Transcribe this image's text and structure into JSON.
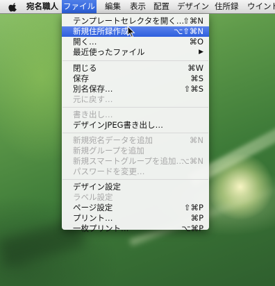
{
  "menubar": {
    "app": "宛名職人",
    "items": [
      "ファイル",
      "編集",
      "表示",
      "配置",
      "デザイン",
      "住所録",
      "ウインド"
    ]
  },
  "file_menu": {
    "items": [
      {
        "label": "テンプレートセレクタを開く…",
        "shortcut": "⇧⌘N",
        "enabled": true
      },
      {
        "label": "新規住所録作成",
        "shortcut": "⌥⇧⌘N",
        "enabled": true,
        "highlighted": true
      },
      {
        "label": "開く…",
        "shortcut": "⌘O",
        "enabled": true
      },
      {
        "label": "最近使ったファイル",
        "shortcut": "▶",
        "enabled": true
      },
      {
        "label": "閉じる",
        "shortcut": "⌘W",
        "enabled": true
      },
      {
        "label": "保存",
        "shortcut": "⌘S",
        "enabled": true
      },
      {
        "label": "別名保存…",
        "shortcut": "⇧⌘S",
        "enabled": true
      },
      {
        "label": "元に戻す…",
        "shortcut": "",
        "enabled": false
      },
      {
        "label": "書き出し…",
        "shortcut": "",
        "enabled": false
      },
      {
        "label": "デザインJPEG書き出し…",
        "shortcut": "",
        "enabled": true
      },
      {
        "label": "新規宛名データを追加",
        "shortcut": "⌘N",
        "enabled": false
      },
      {
        "label": "新規グループを追加",
        "shortcut": "",
        "enabled": false
      },
      {
        "label": "新規スマートグループを追加…",
        "shortcut": "⌥⌘N",
        "enabled": false
      },
      {
        "label": "パスワードを変更…",
        "shortcut": "",
        "enabled": false
      },
      {
        "label": "デザイン設定",
        "shortcut": "",
        "enabled": true
      },
      {
        "label": "ラベル設定",
        "shortcut": "",
        "enabled": false
      },
      {
        "label": "ページ設定",
        "shortcut": "⇧⌘P",
        "enabled": true
      },
      {
        "label": "プリント…",
        "shortcut": "⌘P",
        "enabled": true
      },
      {
        "label": "一枚プリント…",
        "shortcut": "⌥⌘P",
        "enabled": true
      }
    ]
  },
  "icons": {
    "apple": "apple-logo-icon",
    "cursor": "mouse-pointer-icon"
  }
}
